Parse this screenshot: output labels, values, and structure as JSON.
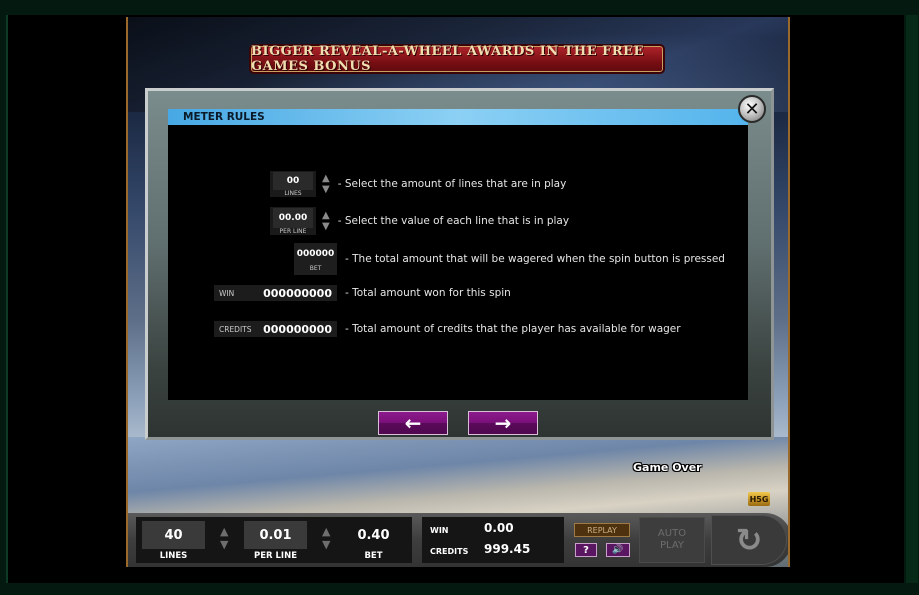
{
  "banner": {
    "text": "BIGGER REVEAL-A-WHEEL AWARDS IN THE FREE GAMES BONUS"
  },
  "modal": {
    "title": "METER RULES",
    "close_icon": "close-icon",
    "rules": [
      {
        "meter_value": "00",
        "meter_label": "LINES",
        "description": "- Select the amount of lines that are in play"
      },
      {
        "meter_value": "00.00",
        "meter_label": "PER LINE",
        "description": "- Select the value of each line that is in play"
      },
      {
        "meter_value": "000000",
        "meter_label": "BET",
        "description": "- The total amount that will be wagered when the spin button is pressed"
      },
      {
        "meter_value": "000000000",
        "meter_label": "WIN",
        "description": "- Total amount won for this spin"
      },
      {
        "meter_value": "000000000",
        "meter_label": "CREDITS",
        "description": "- Total amount of credits that the player has available for wager"
      }
    ],
    "prev_icon": "←",
    "next_icon": "→"
  },
  "status": {
    "game_over": "Game Over",
    "logo": "H5G"
  },
  "controls": {
    "lines": {
      "value": "40",
      "label": "LINES"
    },
    "per_line": {
      "value": "0.01",
      "label": "PER LINE"
    },
    "bet": {
      "value": "0.40",
      "label": "BET"
    },
    "win": {
      "label": "WIN",
      "value": "0.00"
    },
    "credits": {
      "label": "CREDITS",
      "value": "999.45"
    },
    "replay_label": "REPLAY",
    "help_label": "?",
    "sound_icon": "🔊",
    "autoplay_label_1": "AUTO",
    "autoplay_label_2": "PLAY",
    "spin_icon": "↻",
    "up_arrow": "▲",
    "down_arrow": "▼"
  }
}
